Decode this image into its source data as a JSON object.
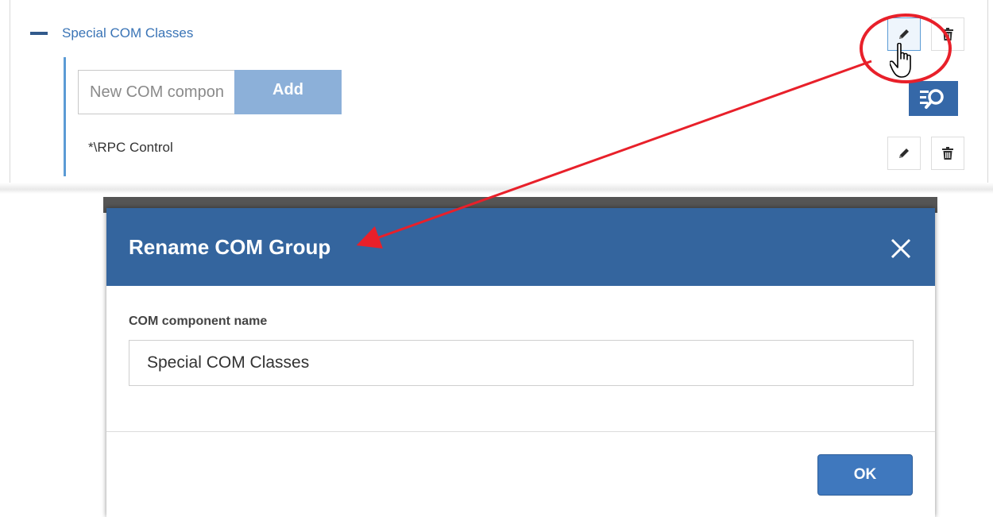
{
  "tree": {
    "group_label": "Special COM Classes",
    "new_component_placeholder": "New COM component",
    "add_label": "Add",
    "items": [
      {
        "label": "*\\RPC Control"
      }
    ]
  },
  "dialog": {
    "title": "Rename COM Group",
    "field_label": "COM component name",
    "field_value": "Special COM Classes",
    "ok_label": "OK"
  },
  "colors": {
    "header_blue": "#34659e",
    "link_blue": "#3a74b6",
    "add_button": "#8cb0d9",
    "annotation_red": "#e8202a"
  },
  "icons": [
    "minus-icon",
    "pencil-icon",
    "trash-icon",
    "filter-search-icon",
    "close-icon",
    "hand-cursor-icon"
  ]
}
